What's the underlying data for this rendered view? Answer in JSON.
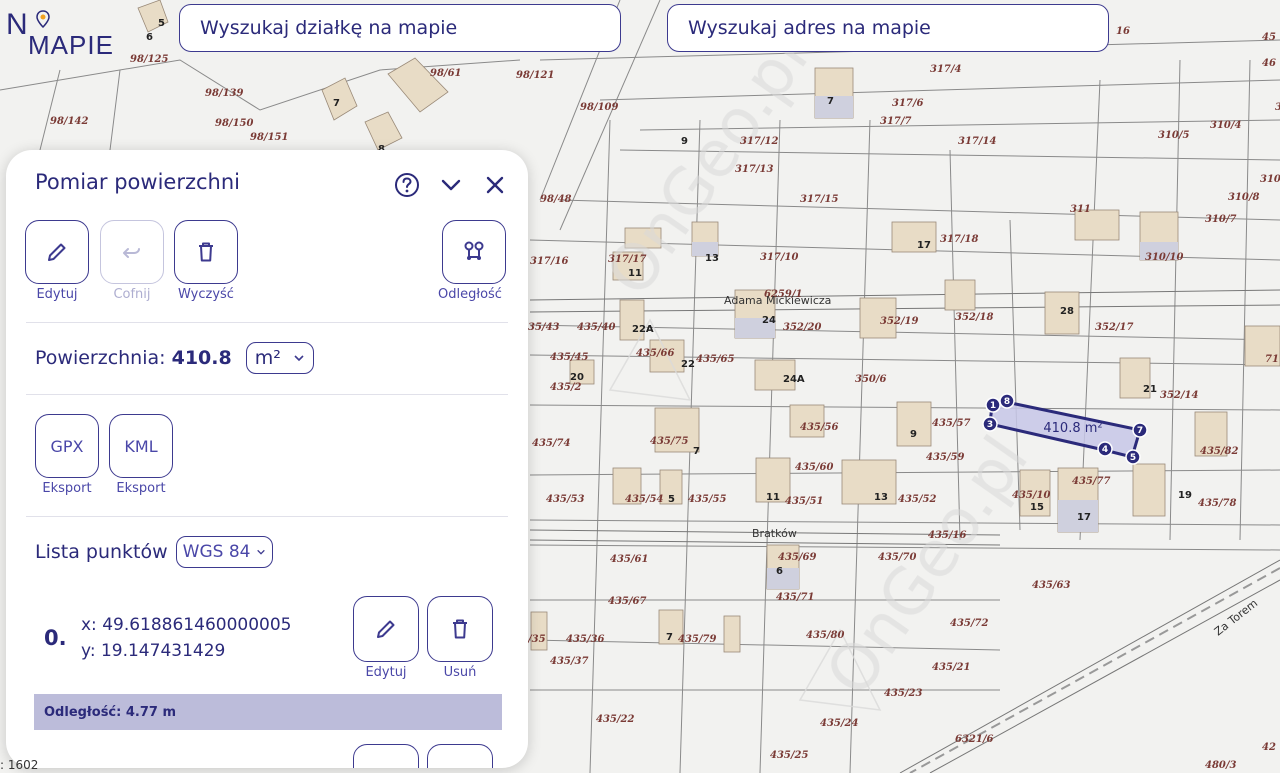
{
  "logo": {
    "letters_top": "N",
    "letters_bottom": "MAPIE"
  },
  "search": {
    "parcel_placeholder": "Wyszukaj działkę na mapie",
    "address_placeholder": "Wyszukaj adres na mapie"
  },
  "panel": {
    "title": "Pomiar powierzchni",
    "tools": {
      "edit": "Edytuj",
      "undo": "Cofnij",
      "clear": "Wyczyść",
      "distance": "Odległość"
    },
    "area_label": "Powierzchnia:",
    "area_value": "410.8",
    "area_unit": "m²",
    "export": {
      "gpx": "GPX",
      "kml": "KML",
      "label": "Eksport"
    },
    "points_title": "Lista punktów",
    "crs": "WGS 84",
    "points": [
      {
        "index": "0.",
        "x": "x: 49.618861460000005",
        "y": "y: 19.147431429",
        "edit": "Edytuj",
        "delete": "Usuń"
      }
    ],
    "distance_text": "Odległość: 4.77 m"
  },
  "map": {
    "streets": [
      "Adama Mickiewicza",
      "Bratków",
      "Za Torem"
    ],
    "measure_label": "410.8 m²",
    "vertex_labels": [
      "1",
      "8",
      "3",
      "4",
      "5",
      "7"
    ],
    "scale_fragment": ": 1602",
    "colors": {
      "accent": "#2b2a7a",
      "polygon_fill": "#c7c7e8",
      "house": "#e8dcc6"
    }
  }
}
